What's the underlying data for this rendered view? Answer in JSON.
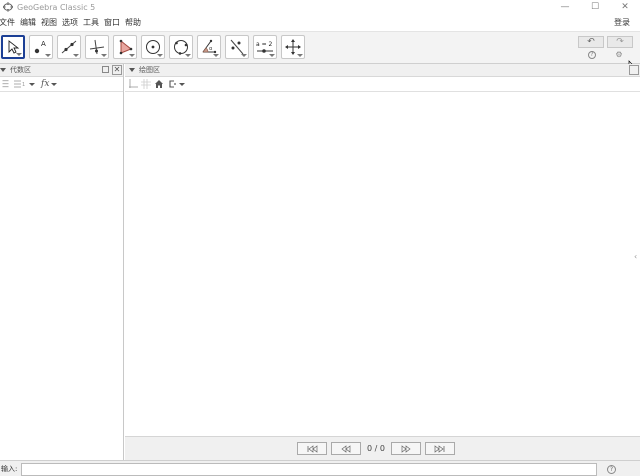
{
  "window": {
    "title": "GeoGebra Classic 5",
    "minimize": "—",
    "maximize": "☐",
    "close": "✕"
  },
  "menu": {
    "items": [
      "文件",
      "编辑",
      "视图",
      "选项",
      "工具",
      "窗口",
      "帮助"
    ],
    "login": "登录"
  },
  "toolbar": {
    "tools": [
      "move-tool",
      "point-tool",
      "line-tool",
      "perpendicular-line-tool",
      "polygon-tool",
      "circle-center-point-tool",
      "circle-three-points-tool",
      "angle-tool",
      "reflect-tool",
      "slider-tool",
      "move-graphics-view-tool"
    ],
    "slider_label": "a = 2",
    "undo": "↶",
    "redo": "↷",
    "help": "?",
    "settings": "⚙"
  },
  "algebra": {
    "title": "代数区",
    "fx": "fx"
  },
  "graphics": {
    "title": "绘图区",
    "nav_counter": "0 / 0"
  },
  "input": {
    "label": "输入:",
    "value": "",
    "help": "?"
  }
}
